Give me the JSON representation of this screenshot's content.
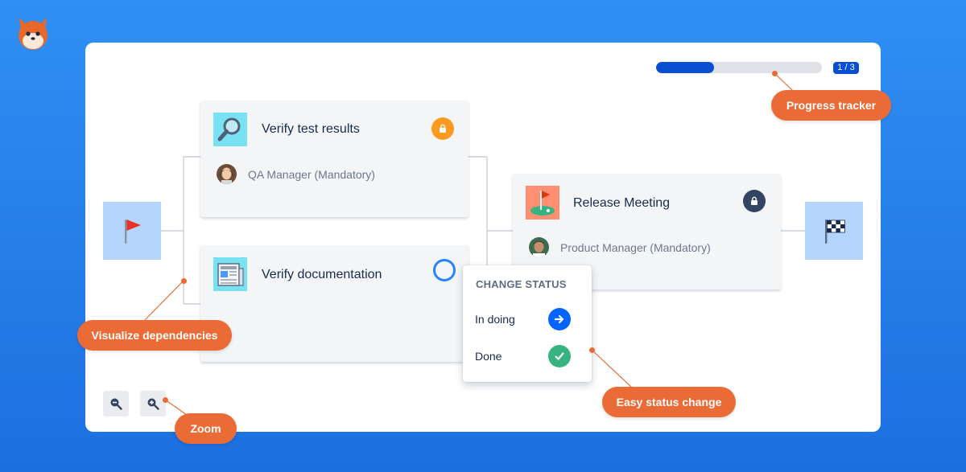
{
  "progress": {
    "fraction": 0.35,
    "label": "1 / 3"
  },
  "nodes": {
    "start_icon": "red-flag-icon",
    "finish_icon": "checkered-flag-icon"
  },
  "cards": [
    {
      "title": "Verify test results",
      "icon": "magnifying-glass-icon",
      "status": "locked",
      "status_color": "#ff991f",
      "assignee": "QA Manager (Mandatory)"
    },
    {
      "title": "Verify documentation",
      "icon": "newspaper-icon",
      "status": "open",
      "status_color": "#2684ff"
    },
    {
      "title": "Release Meeting",
      "icon": "golf-flag-icon",
      "status": "locked",
      "status_color": "#344563",
      "assignee": "Product Manager (Mandatory)"
    }
  ],
  "status_menu": {
    "heading": "CHANGE STATUS",
    "options": [
      {
        "label": "In doing",
        "icon": "arrow-right-icon",
        "color": "#0065ff"
      },
      {
        "label": "Done",
        "icon": "checkmark-icon",
        "color": "#36b37e"
      }
    ]
  },
  "zoom": {
    "out_icon": "zoom-out-icon",
    "in_icon": "zoom-in-icon"
  },
  "callouts": {
    "progress": "Progress tracker",
    "dependencies": "Visualize dependencies",
    "status": "Easy status change",
    "zoom": "Zoom"
  },
  "colors": {
    "background": "#2f8ff3",
    "accent": "#ea6b35",
    "progress": "#0a4fd1"
  }
}
